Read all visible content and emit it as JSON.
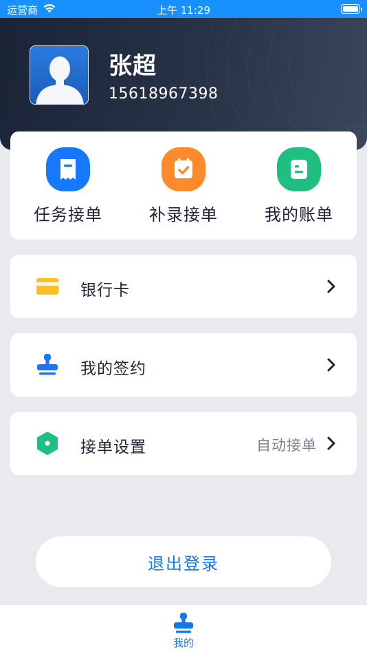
{
  "status_bar": {
    "carrier": "运营商",
    "time": "上午 11:29"
  },
  "profile": {
    "name": "张超",
    "phone": "15618967398"
  },
  "quick_actions": [
    {
      "label": "任务接单",
      "icon": "receipt-icon",
      "color": "#1677ff"
    },
    {
      "label": "补录接单",
      "icon": "check-box-icon",
      "color": "#ff8a2b"
    },
    {
      "label": "我的账单",
      "icon": "document-icon",
      "color": "#1fbf82"
    }
  ],
  "menu": [
    {
      "label": "银行卡",
      "icon": "bank-card-icon",
      "value": "",
      "icon_color": "#ffbf1f"
    },
    {
      "label": "我的签约",
      "icon": "stamp-icon",
      "value": "",
      "icon_color": "#1677ff"
    },
    {
      "label": "接单设置",
      "icon": "settings-hexagon-icon",
      "value": "自动接单",
      "icon_color": "#1fbf82"
    }
  ],
  "logout_label": "退出登录",
  "tab_bar": {
    "items": [
      {
        "label": "我的",
        "icon": "stamp-icon",
        "active": true
      }
    ]
  }
}
